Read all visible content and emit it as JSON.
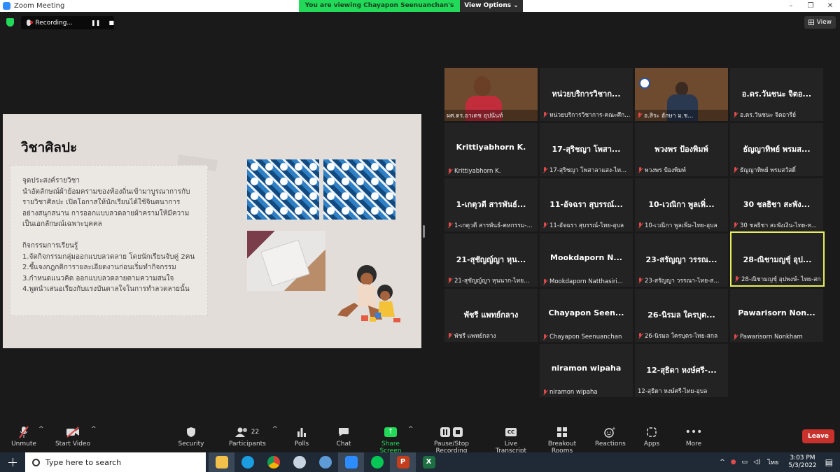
{
  "window": {
    "title": "Zoom Meeting",
    "controls": [
      "–",
      "❐",
      "✕"
    ]
  },
  "share_banner": {
    "message": "You are viewing Chayapon Seenuanchan's screen",
    "options_label": "View Options ⌄"
  },
  "recording": {
    "label": "Recording..."
  },
  "view_button": {
    "label": "View"
  },
  "slide": {
    "title": "วิชาศิลปะ",
    "lines": [
      "จุดประสงค์รายวิชา",
      "นำอัตลักษณ์ผ้าย้อมครามของท้องถิ่นเข้ามาบูรณาการกับ",
      "รายวิชาศิลปะ เปิดโอกาสให้นักเรียนได้ใช้จินตนาการ",
      "อย่างสนุกสนาน การออกแบบลวดลายผ้าครามให้มีความ",
      "เป็นเอกลักษณ์เฉพาะบุคคล",
      "",
      "กิจกรรมการเรียนรู้",
      "1.จัดกิจกรรมกลุ่มออกแบบลวดลาย โดยนักเรียนจับคู่ 2คน",
      "2.ชี้แจงกฎกติการายละเอียดงานก่อนเริ่มทำกิจกรรม",
      "3.กำหนดแนวคิด ออกแบบลวดลายตามความสนใจ",
      "4.พูดนำเสนอเรียงกับแรงบันดาลใจในการทำลวดลายนั้น"
    ]
  },
  "participants": [
    {
      "display": "",
      "name": "ผศ.ดร.อาเดช อุปนันท์"
    },
    {
      "display": "หน่วยบริการวิชาก...",
      "name": "หน่วยบริการวิชาการ-คณะศึก..."
    },
    {
      "display": "",
      "name": "อ.สิระ ฮักษา ม.ช..."
    },
    {
      "display": "อ.ดร.วันชนะ จิตอ...",
      "name": "อ.ดร.วันชนะ จิตอารีย์"
    },
    {
      "display": "Krittiyabhorn K.",
      "name": "Krittiyabhorn K."
    },
    {
      "display": "17-สุริชญา โพสา...",
      "name": "17-สุริชญา โพสาลาแสง-ไท..."
    },
    {
      "display": "พวงพร ป้องพิมพ์",
      "name": "พวงพร ป้องพิมพ์"
    },
    {
      "display": "ธัญญาทิพย์ พรมส...",
      "name": "ธัญญาทิพย์ พรมสวัสดิ์"
    },
    {
      "display": "1-เกตุวดี สารพันธ์...",
      "name": "1-เกตุวดี สารพันธ์-คหกรรม-..."
    },
    {
      "display": "11-อัจฉรา สุบรรณ์...",
      "name": "11-อัจฉรา สุบรรณ์-ไทย-อุบล"
    },
    {
      "display": "10-เวณิกา พูลเพิ่...",
      "name": "10-เวณิกา พูลเพิ่ม-ไทย-อุบล"
    },
    {
      "display": "30 ชลธิชา สะพัง...",
      "name": "30 ชลธิชา สะพังเงิน-ไทย-ห..."
    },
    {
      "display": "21-สุชัญญ์ญา หุน...",
      "name": "21-สุชัญญ์ญา หุนนาก-ไทย..."
    },
    {
      "display": "Mookdaporn N...",
      "name": "Mookdaporn Natthasiri..."
    },
    {
      "display": "23-สรัญญา วรรณ...",
      "name": "23-สรัญญา วรรณา-ไทย-ส..."
    },
    {
      "display": "28-ณิชามญชุ์ อุป...",
      "name": "28-ณิชามญชุ์ อุปพงษ์- ไทย-สกล"
    },
    {
      "display": "พัชรี แพทย์กลาง",
      "name": "พัชรี แพทย์กลาง"
    },
    {
      "display": "Chayapon Seen...",
      "name": "Chayapon Seenuanchan"
    },
    {
      "display": "26-นิรมล ใครบุต...",
      "name": "26-นิรมล ใครบุตร-ไทย-สกล"
    },
    {
      "display": "Pawarisorn Non...",
      "name": "Pawarisorn Nonkham"
    },
    {
      "display": "niramon wipaha",
      "name": "niramon wipaha"
    },
    {
      "display": "12-สุธิดา หงษ์ศรี-...",
      "name": "12-สุธิดา หงษ์ศรี-ไทย-อุบล"
    }
  ],
  "toolbar": {
    "unmute": "Unmute",
    "start_video": "Start Video",
    "security": "Security",
    "participants": "Participants",
    "participants_count": "22",
    "polls": "Polls",
    "chat": "Chat",
    "share_screen": "Share Screen",
    "pause_recording": "Pause/Stop Recording",
    "live_transcript": "Live Transcript",
    "breakout_rooms": "Breakout Rooms",
    "reactions": "Reactions",
    "apps": "Apps",
    "more": "More",
    "leave": "Leave",
    "cc_icon_text": "CC"
  },
  "taskbar": {
    "search_placeholder": "Type here to search",
    "lang": "ไทย",
    "time": "3:03 PM",
    "date": "5/3/2022"
  },
  "colors": {
    "accent_green": "#23d959",
    "leave_red": "#c8312c",
    "active_speaker": "#e8ef5a",
    "muted_red": "#e04b4b"
  }
}
